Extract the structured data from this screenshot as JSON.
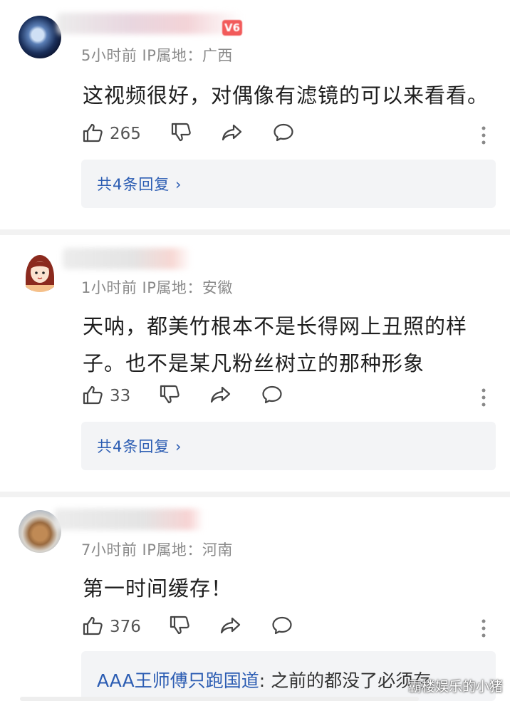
{
  "comments": [
    {
      "meta": "5小时前 IP属地：广西",
      "text_lines": [
        "这视频很好，对偶像有滤镜的可以来看看。"
      ],
      "likes": "265",
      "replies_label": "共4条回复 ›",
      "badge": "V6"
    },
    {
      "meta": "1小时前 IP属地：安徽",
      "text_lines": [
        "天呐，都美竹根本不是长得网上丑照的样",
        "子。也不是某凡粉丝树立的那种形象"
      ],
      "likes": "33",
      "replies_label": "共4条回复 ›"
    },
    {
      "meta": "7小时前 IP属地：河南",
      "text_lines": [
        "第一时间缓存！"
      ],
      "likes": "376",
      "reply_preview": {
        "author": "AAA王师傅只跑国道",
        "body": ": 之前的都没了必须存"
      }
    }
  ],
  "watermark": "霸楼娱乐的小猪",
  "icons": {
    "like": "thumbs-up-icon",
    "dislike": "thumbs-down-icon",
    "share": "share-icon",
    "comment": "comment-icon",
    "more": "more-vertical-icon"
  },
  "colors": {
    "link": "#2c5db3",
    "meta": "#8a8a8a",
    "reply_bg": "#f3f4f6"
  }
}
